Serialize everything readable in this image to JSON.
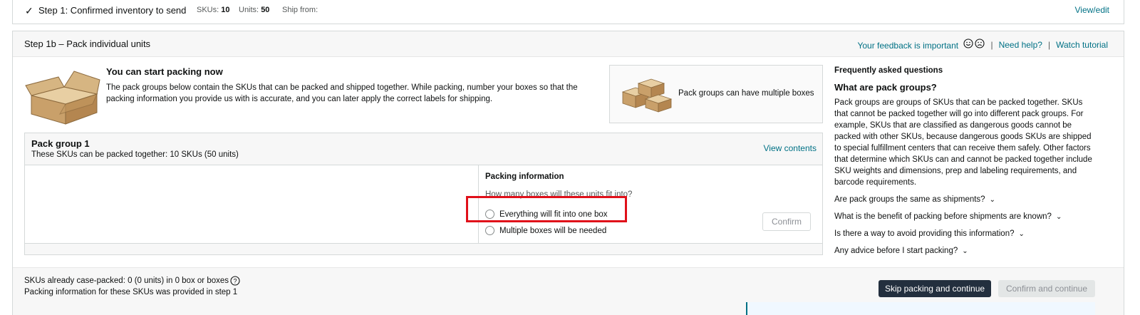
{
  "step1": {
    "title": "Step 1: Confirmed inventory to send",
    "skus_label": "SKUs:",
    "skus_value": "10",
    "units_label": "Units:",
    "units_value": "50",
    "ship_from_label": "Ship from:",
    "edit_link": "View/edit"
  },
  "step1b": {
    "title": "Step 1b – Pack individual units",
    "feedback_link": "Your feedback is important",
    "help_link": "Need help?",
    "tutorial_link": "Watch tutorial",
    "separator": "|"
  },
  "intro": {
    "title": "You can start packing now",
    "text": "The pack groups below contain the SKUs that can be packed and shipped together. While packing, number your boxes so that the packing information you provide us with is accurate, and you can later apply the correct labels for shipping."
  },
  "multi_card": {
    "text": "Pack groups can have multiple boxes"
  },
  "pack_group": {
    "title": "Pack group 1",
    "subtitle": "These SKUs can be packed together: 10 SKUs (50 units)",
    "view_contents": "View contents",
    "packing_info_title": "Packing information",
    "question": "How many boxes will these units fit into?",
    "options": [
      "Everything will fit into one box",
      "Multiple boxes will be needed"
    ],
    "confirm_label": "Confirm"
  },
  "faq": {
    "heading": "Frequently asked questions",
    "question_title": "What are pack groups?",
    "answer": "Pack groups are groups of SKUs that can be packed together. SKUs that cannot be packed together will go into different pack groups. For example, SKUs that are classified as dangerous goods cannot be packed with other SKUs, because dangerous goods SKUs are shipped to special fulfillment centers that can receive them safely. Other factors that determine which SKUs can and cannot be packed together include SKU weights and dimensions, prep and labeling requirements, and barcode requirements.",
    "questions": [
      "Are pack groups the same as shipments?",
      "What is the benefit of packing before shipments are known?",
      "Is there a way to avoid providing this information?",
      "Any advice before I start packing?"
    ]
  },
  "bottom": {
    "case_packed": "SKUs already case-packed: 0 (0 units) in 0 box or boxes",
    "provided_note": "Packing information for these SKUs was provided in step 1",
    "skip_button": "Skip packing and continue",
    "confirm_button": "Confirm and continue"
  },
  "colors": {
    "link": "#007185",
    "primary_button": "#232f3e",
    "highlight": "#e0101a"
  }
}
